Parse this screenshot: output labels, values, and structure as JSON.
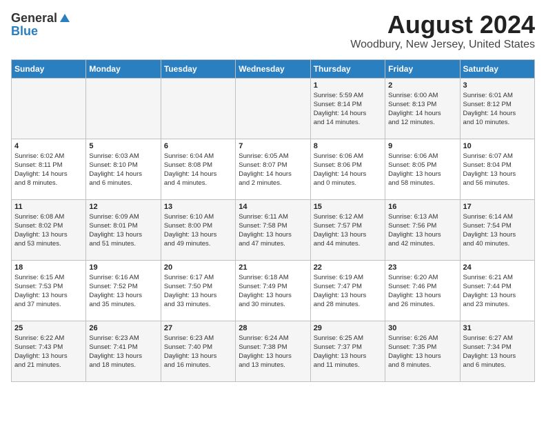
{
  "header": {
    "logo_general": "General",
    "logo_blue": "Blue",
    "month_title": "August 2024",
    "location": "Woodbury, New Jersey, United States"
  },
  "days_of_week": [
    "Sunday",
    "Monday",
    "Tuesday",
    "Wednesday",
    "Thursday",
    "Friday",
    "Saturday"
  ],
  "weeks": [
    [
      {
        "day": "",
        "info": ""
      },
      {
        "day": "",
        "info": ""
      },
      {
        "day": "",
        "info": ""
      },
      {
        "day": "",
        "info": ""
      },
      {
        "day": "1",
        "info": "Sunrise: 5:59 AM\nSunset: 8:14 PM\nDaylight: 14 hours\nand 14 minutes."
      },
      {
        "day": "2",
        "info": "Sunrise: 6:00 AM\nSunset: 8:13 PM\nDaylight: 14 hours\nand 12 minutes."
      },
      {
        "day": "3",
        "info": "Sunrise: 6:01 AM\nSunset: 8:12 PM\nDaylight: 14 hours\nand 10 minutes."
      }
    ],
    [
      {
        "day": "4",
        "info": "Sunrise: 6:02 AM\nSunset: 8:11 PM\nDaylight: 14 hours\nand 8 minutes."
      },
      {
        "day": "5",
        "info": "Sunrise: 6:03 AM\nSunset: 8:10 PM\nDaylight: 14 hours\nand 6 minutes."
      },
      {
        "day": "6",
        "info": "Sunrise: 6:04 AM\nSunset: 8:08 PM\nDaylight: 14 hours\nand 4 minutes."
      },
      {
        "day": "7",
        "info": "Sunrise: 6:05 AM\nSunset: 8:07 PM\nDaylight: 14 hours\nand 2 minutes."
      },
      {
        "day": "8",
        "info": "Sunrise: 6:06 AM\nSunset: 8:06 PM\nDaylight: 14 hours\nand 0 minutes."
      },
      {
        "day": "9",
        "info": "Sunrise: 6:06 AM\nSunset: 8:05 PM\nDaylight: 13 hours\nand 58 minutes."
      },
      {
        "day": "10",
        "info": "Sunrise: 6:07 AM\nSunset: 8:04 PM\nDaylight: 13 hours\nand 56 minutes."
      }
    ],
    [
      {
        "day": "11",
        "info": "Sunrise: 6:08 AM\nSunset: 8:02 PM\nDaylight: 13 hours\nand 53 minutes."
      },
      {
        "day": "12",
        "info": "Sunrise: 6:09 AM\nSunset: 8:01 PM\nDaylight: 13 hours\nand 51 minutes."
      },
      {
        "day": "13",
        "info": "Sunrise: 6:10 AM\nSunset: 8:00 PM\nDaylight: 13 hours\nand 49 minutes."
      },
      {
        "day": "14",
        "info": "Sunrise: 6:11 AM\nSunset: 7:58 PM\nDaylight: 13 hours\nand 47 minutes."
      },
      {
        "day": "15",
        "info": "Sunrise: 6:12 AM\nSunset: 7:57 PM\nDaylight: 13 hours\nand 44 minutes."
      },
      {
        "day": "16",
        "info": "Sunrise: 6:13 AM\nSunset: 7:56 PM\nDaylight: 13 hours\nand 42 minutes."
      },
      {
        "day": "17",
        "info": "Sunrise: 6:14 AM\nSunset: 7:54 PM\nDaylight: 13 hours\nand 40 minutes."
      }
    ],
    [
      {
        "day": "18",
        "info": "Sunrise: 6:15 AM\nSunset: 7:53 PM\nDaylight: 13 hours\nand 37 minutes."
      },
      {
        "day": "19",
        "info": "Sunrise: 6:16 AM\nSunset: 7:52 PM\nDaylight: 13 hours\nand 35 minutes."
      },
      {
        "day": "20",
        "info": "Sunrise: 6:17 AM\nSunset: 7:50 PM\nDaylight: 13 hours\nand 33 minutes."
      },
      {
        "day": "21",
        "info": "Sunrise: 6:18 AM\nSunset: 7:49 PM\nDaylight: 13 hours\nand 30 minutes."
      },
      {
        "day": "22",
        "info": "Sunrise: 6:19 AM\nSunset: 7:47 PM\nDaylight: 13 hours\nand 28 minutes."
      },
      {
        "day": "23",
        "info": "Sunrise: 6:20 AM\nSunset: 7:46 PM\nDaylight: 13 hours\nand 26 minutes."
      },
      {
        "day": "24",
        "info": "Sunrise: 6:21 AM\nSunset: 7:44 PM\nDaylight: 13 hours\nand 23 minutes."
      }
    ],
    [
      {
        "day": "25",
        "info": "Sunrise: 6:22 AM\nSunset: 7:43 PM\nDaylight: 13 hours\nand 21 minutes."
      },
      {
        "day": "26",
        "info": "Sunrise: 6:23 AM\nSunset: 7:41 PM\nDaylight: 13 hours\nand 18 minutes."
      },
      {
        "day": "27",
        "info": "Sunrise: 6:23 AM\nSunset: 7:40 PM\nDaylight: 13 hours\nand 16 minutes."
      },
      {
        "day": "28",
        "info": "Sunrise: 6:24 AM\nSunset: 7:38 PM\nDaylight: 13 hours\nand 13 minutes."
      },
      {
        "day": "29",
        "info": "Sunrise: 6:25 AM\nSunset: 7:37 PM\nDaylight: 13 hours\nand 11 minutes."
      },
      {
        "day": "30",
        "info": "Sunrise: 6:26 AM\nSunset: 7:35 PM\nDaylight: 13 hours\nand 8 minutes."
      },
      {
        "day": "31",
        "info": "Sunrise: 6:27 AM\nSunset: 7:34 PM\nDaylight: 13 hours\nand 6 minutes."
      }
    ]
  ]
}
